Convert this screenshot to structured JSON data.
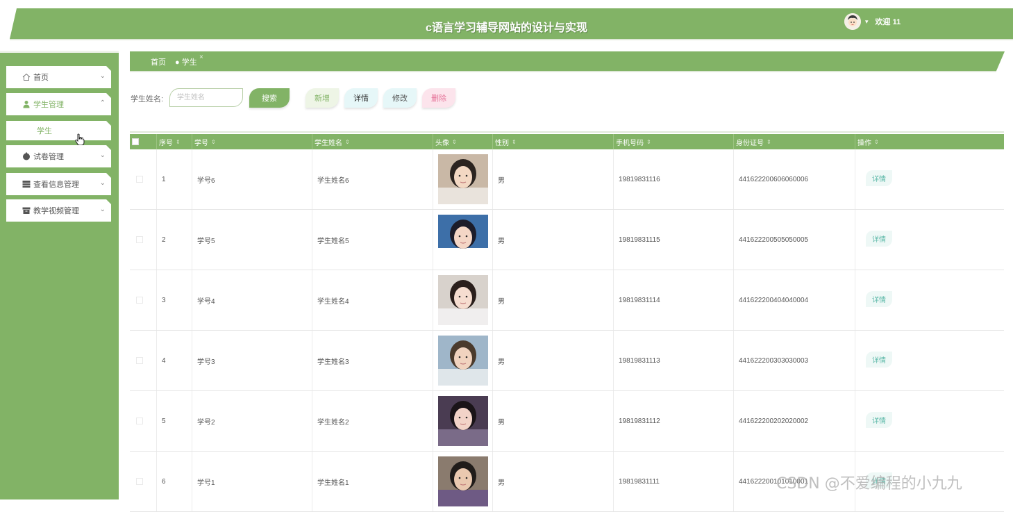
{
  "header": {
    "title": "c语言学习辅导网站的设计与实现",
    "welcome": "欢迎 11",
    "accent": "#82b366"
  },
  "sidebar": {
    "items": [
      {
        "label": "首页",
        "icon": "home-icon"
      },
      {
        "label": "学生管理",
        "icon": "user-icon"
      },
      {
        "label": "试卷管理",
        "icon": "circle-icon"
      },
      {
        "label": "查看信息管理",
        "icon": "list-icon"
      },
      {
        "label": "教学视频管理",
        "icon": "box-icon"
      }
    ],
    "sub_item": "学生"
  },
  "tabs": {
    "home": "首页",
    "current": "● 学生",
    "close": "×"
  },
  "search": {
    "label": "学生姓名:",
    "placeholder": "学生姓名",
    "search_btn": "搜索",
    "add_btn": "新增",
    "detail_btn": "详情",
    "edit_btn": "修改",
    "delete_btn": "删除"
  },
  "table": {
    "columns": [
      "序号",
      "学号",
      "学生姓名",
      "头像",
      "性别",
      "手机号码",
      "身份证号",
      "操作"
    ],
    "action_label": "详情",
    "rows": [
      {
        "no": "1",
        "sid": "学号6",
        "name": "学生姓名6",
        "gender": "男",
        "phone": "19819831116",
        "idcard": "441622200606060006"
      },
      {
        "no": "2",
        "sid": "学号5",
        "name": "学生姓名5",
        "gender": "男",
        "phone": "19819831115",
        "idcard": "441622200505050005"
      },
      {
        "no": "3",
        "sid": "学号4",
        "name": "学生姓名4",
        "gender": "男",
        "phone": "19819831114",
        "idcard": "441622200404040004"
      },
      {
        "no": "4",
        "sid": "学号3",
        "name": "学生姓名3",
        "gender": "男",
        "phone": "19819831113",
        "idcard": "441622200303030003"
      },
      {
        "no": "5",
        "sid": "学号2",
        "name": "学生姓名2",
        "gender": "男",
        "phone": "19819831112",
        "idcard": "441622200202020002"
      },
      {
        "no": "6",
        "sid": "学号1",
        "name": "学生姓名1",
        "gender": "男",
        "phone": "19819831111",
        "idcard": "441622200101010001"
      }
    ]
  },
  "watermark": "CSDN @不爱编程的小九九"
}
